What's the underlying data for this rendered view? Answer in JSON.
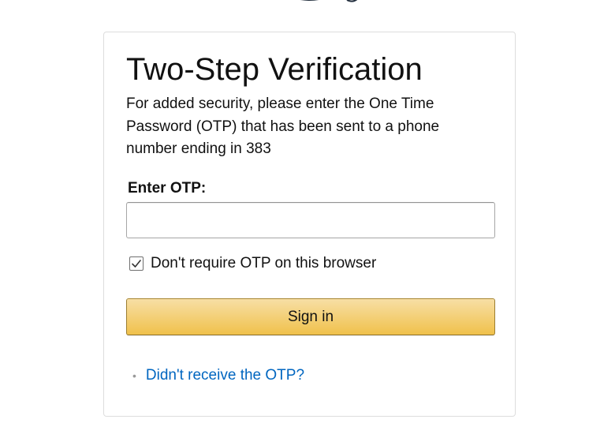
{
  "logo": {
    "icon": "brand-logo-icon",
    "color": "#232f3e"
  },
  "card": {
    "title": "Two-Step Verification",
    "description": "For added security, please enter the One Time Password (OTP) that has been sent to a phone number ending in 383"
  },
  "otp": {
    "label": "Enter OTP:",
    "value": "",
    "placeholder": ""
  },
  "remember": {
    "label": "Don't require OTP on this browser",
    "checked": true
  },
  "signin": {
    "label": "Sign in"
  },
  "help": {
    "bullet": "•",
    "link_label": "Didn't receive the OTP?"
  },
  "colors": {
    "link": "#0066c0",
    "button_top": "#f7dfa5",
    "button_bottom": "#f0c14b",
    "button_border": "#a88734"
  }
}
